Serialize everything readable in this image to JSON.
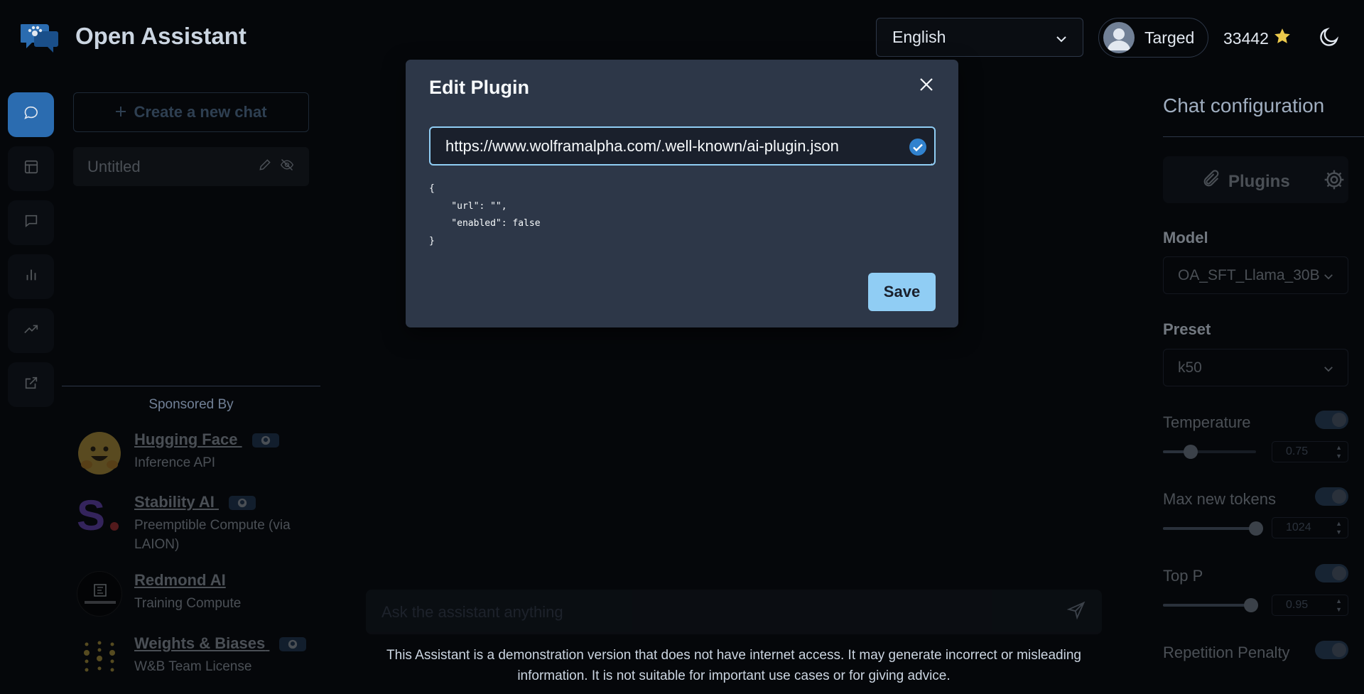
{
  "header": {
    "brand": "Open Assistant",
    "language": "English",
    "username": "Targed",
    "score": "33442"
  },
  "sidebar": {
    "new_chat_label": "Create a new chat",
    "chats": [
      {
        "title": "Untitled"
      }
    ],
    "sponsored_by": "Sponsored By",
    "sponsors": [
      {
        "name": "Hugging Face",
        "desc": "Inference API"
      },
      {
        "name": "Stability AI",
        "desc": "Preemptible Compute (via LAION)"
      },
      {
        "name": "Redmond AI",
        "desc": "Training Compute"
      },
      {
        "name": "Weights & Biases",
        "desc": "W&B Team License"
      }
    ]
  },
  "chat": {
    "input_placeholder": "Ask the assistant anything",
    "disclaimer": "This Assistant is a demonstration version that does not have internet access. It may generate incorrect or misleading information. It is not suitable for important use cases or for giving advice."
  },
  "config": {
    "title": "Chat configuration",
    "plugins_label": "Plugins",
    "model_label": "Model",
    "model_value": "OA_SFT_Llama_30B",
    "preset_label": "Preset",
    "preset_value": "k50",
    "params": [
      {
        "label": "Temperature",
        "value": "0.75",
        "fraction": 0.3
      },
      {
        "label": "Max new tokens",
        "value": "1024",
        "fraction": 1.0
      },
      {
        "label": "Top P",
        "value": "0.95",
        "fraction": 0.95
      },
      {
        "label": "Repetition Penalty"
      }
    ]
  },
  "modal": {
    "title": "Edit Plugin",
    "url_value": "https://www.wolframalpha.com/.well-known/ai-plugin.json",
    "json_preview": "{\n    \"url\": \"\",\n    \"enabled\": false\n}",
    "save_label": "Save"
  },
  "colors": {
    "accent": "#90cdf4",
    "modal_bg": "#2d3748",
    "page_bg": "#05070a",
    "active_rail": "#2b6cb0",
    "check": "#3182ce"
  },
  "icons": {
    "rail": [
      "chat-icon",
      "layout-icon",
      "message-icon",
      "bar-chart-icon",
      "trending-icon",
      "external-link-icon"
    ]
  }
}
